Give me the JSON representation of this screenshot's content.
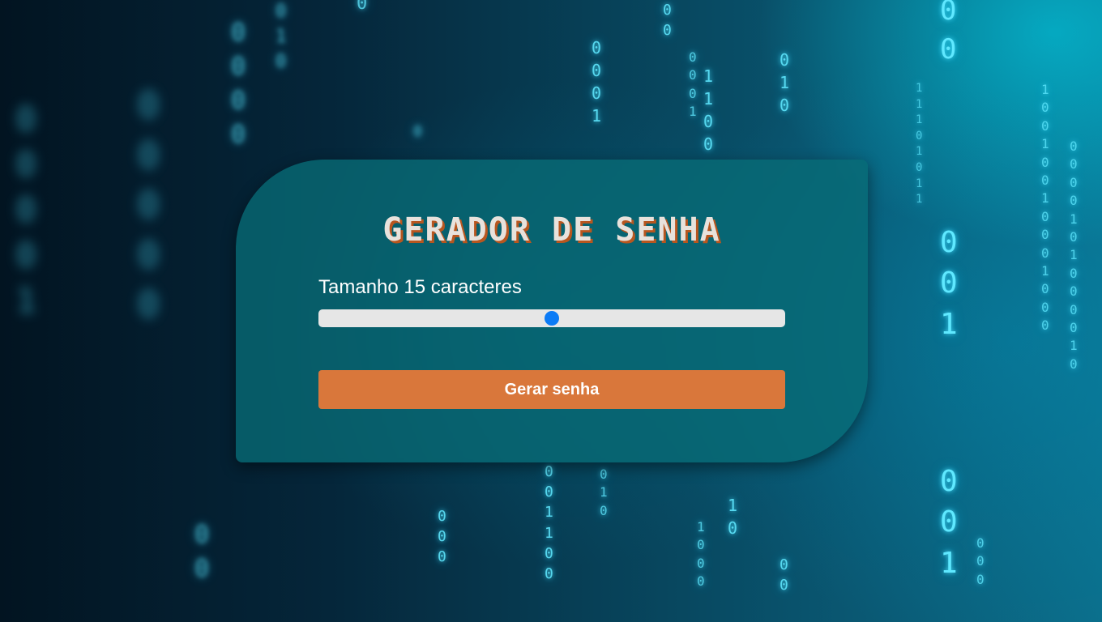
{
  "app": {
    "title": "GERADOR DE SENHA"
  },
  "length": {
    "prefix": "Tamanho",
    "value": "15",
    "suffix": "caracteres",
    "slider_fraction": 0.5
  },
  "actions": {
    "generate_label": "Gerar senha"
  },
  "colors": {
    "card_background": "#086c76",
    "button_background": "#d9773b",
    "title_shadow": "#b8561f",
    "slider_thumb": "#0b7bf6",
    "slider_track": "#e6e6e6"
  },
  "background": {
    "description_icon": "binary-code-rain-image"
  }
}
